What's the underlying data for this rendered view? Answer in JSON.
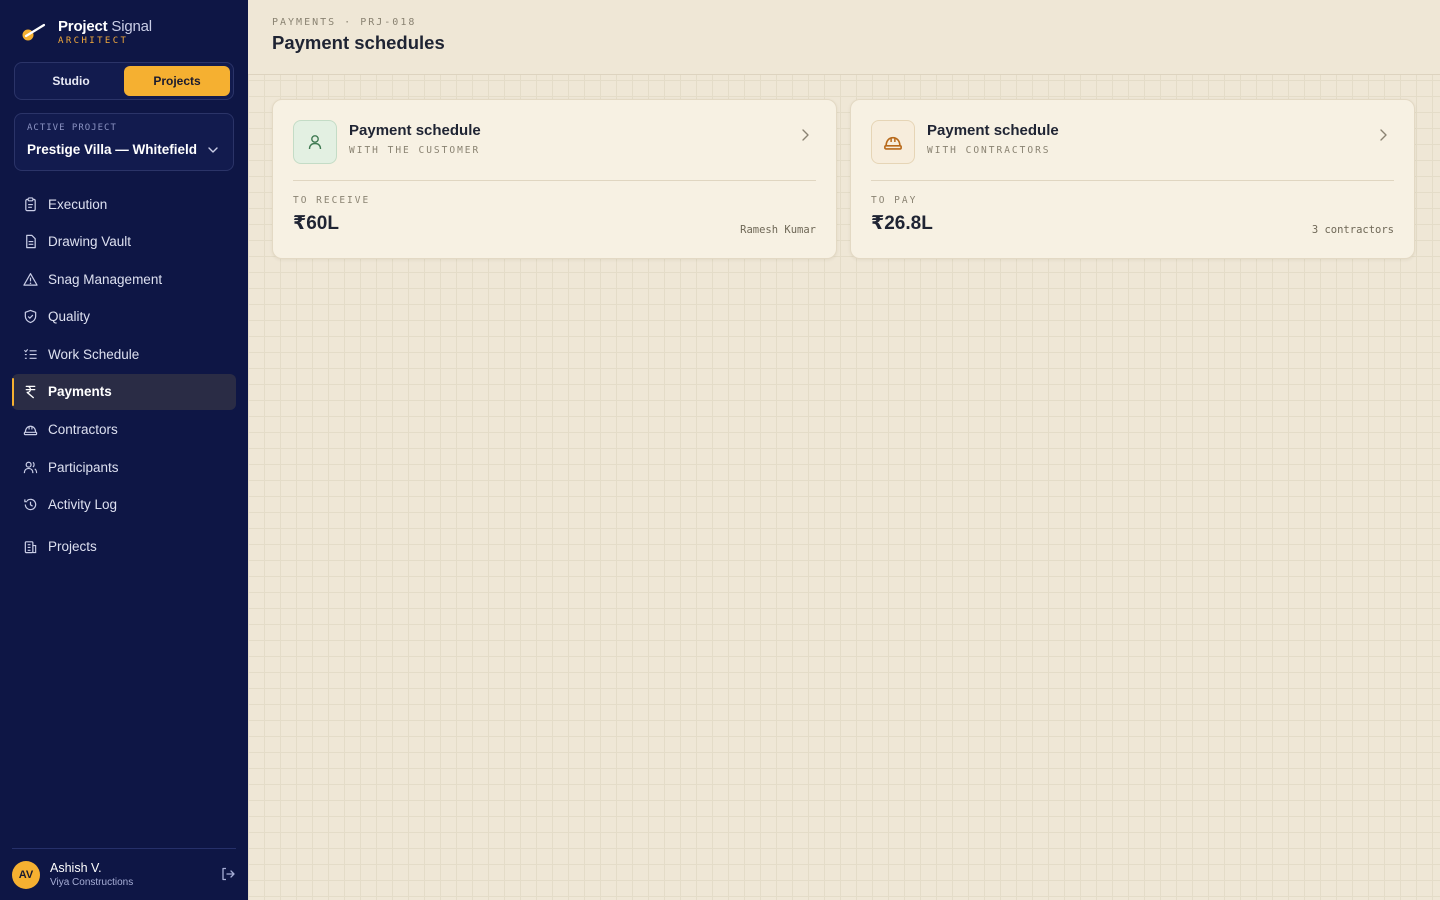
{
  "brand": {
    "name_bold": "Project",
    "name_light": "Signal",
    "subtitle": "ARCHITECT"
  },
  "mode_switch": {
    "options": [
      "Studio",
      "Projects"
    ],
    "selected": "Projects"
  },
  "active_project": {
    "label": "ACTIVE PROJECT",
    "name": "Prestige Villa — Whitefield"
  },
  "nav": {
    "items": [
      {
        "label": "Execution",
        "icon": "clipboard-icon"
      },
      {
        "label": "Drawing Vault",
        "icon": "document-icon"
      },
      {
        "label": "Snag Management",
        "icon": "warning-triangle-icon"
      },
      {
        "label": "Quality",
        "icon": "shield-check-icon"
      },
      {
        "label": "Work Schedule",
        "icon": "checklist-icon"
      },
      {
        "label": "Payments",
        "icon": "rupee-icon",
        "active": true
      },
      {
        "label": "Contractors",
        "icon": "hard-hat-icon"
      },
      {
        "label": "Participants",
        "icon": "users-icon"
      },
      {
        "label": "Activity Log",
        "icon": "history-icon"
      }
    ],
    "projects_label": "Projects"
  },
  "user": {
    "initials": "AV",
    "name": "Ashish V.",
    "org": "Viya Constructions"
  },
  "header": {
    "breadcrumb": "PAYMENTS · PRJ-018",
    "title": "Payment schedules"
  },
  "cards": [
    {
      "title": "Payment schedule",
      "subtitle": "WITH THE CUSTOMER",
      "amount_label": "TO RECEIVE",
      "amount": "₹60L",
      "meta": "Ramesh Kumar",
      "icon": "person-icon",
      "icon_color": "#3f7a52"
    },
    {
      "title": "Payment schedule",
      "subtitle": "WITH CONTRACTORS",
      "amount_label": "TO PAY",
      "amount": "₹26.8L",
      "meta": "3 contractors",
      "icon": "hard-hat-icon",
      "icon_color": "#b86a1b"
    }
  ],
  "colors": {
    "sidebar": "#0e1645",
    "accent": "#f5b031",
    "background": "#efe7d6",
    "card": "#f7f1e3"
  }
}
